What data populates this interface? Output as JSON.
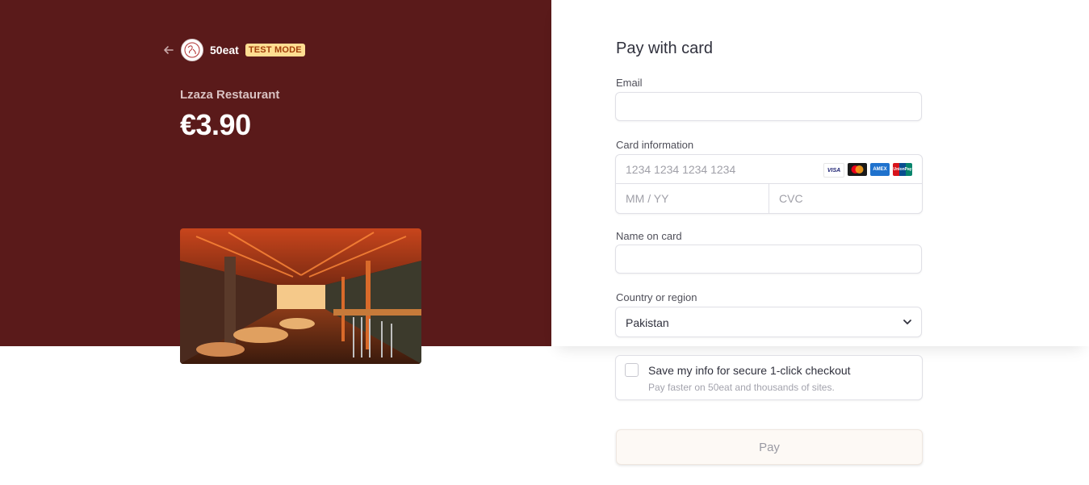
{
  "header": {
    "brand_name": "50eat",
    "test_mode_label": "TEST MODE"
  },
  "summary": {
    "merchant": "Lzaza Restaurant",
    "amount": "€3.90"
  },
  "form": {
    "title": "Pay with card",
    "email_label": "Email",
    "email_value": "",
    "card_label": "Card information",
    "card_number_placeholder": "1234 1234 1234 1234",
    "expiry_placeholder": "MM / YY",
    "cvc_placeholder": "CVC",
    "card_brands": [
      "VISA",
      "mastercard",
      "AMEX",
      "UnionPay"
    ],
    "name_label": "Name on card",
    "name_value": "",
    "country_label": "Country or region",
    "country_value": "Pakistan"
  },
  "save_info": {
    "title": "Save my info for secure 1-click checkout",
    "subtitle": "Pay faster on 50eat and thousands of sites.",
    "checked": false
  },
  "pay_button_label": "Pay",
  "colors": {
    "left_panel": "#5a1a1a",
    "badge_bg": "#ffde92",
    "badge_text": "#a13f0b"
  }
}
